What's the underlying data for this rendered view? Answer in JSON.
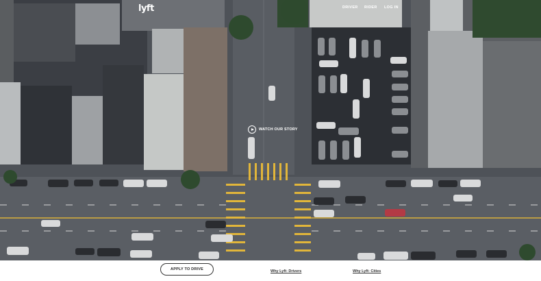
{
  "brand": {
    "logo_text": "lyft"
  },
  "nav": {
    "drivers": "DRIVER",
    "riders": "RIDER",
    "login": "LOG IN"
  },
  "hero": {
    "watch_label": "WATCH OUR STORY"
  },
  "footer": {
    "apply_label": "APPLY TO DRIVE",
    "why_drivers": "Why Lyft: Drivers",
    "why_cities": "Why Lyft: Cities"
  },
  "colors": {
    "road": "#5b5f66",
    "crosswalk": "#e2b63a",
    "roof_light": "#c9cbc8",
    "roof_dark": "#3d4148"
  }
}
